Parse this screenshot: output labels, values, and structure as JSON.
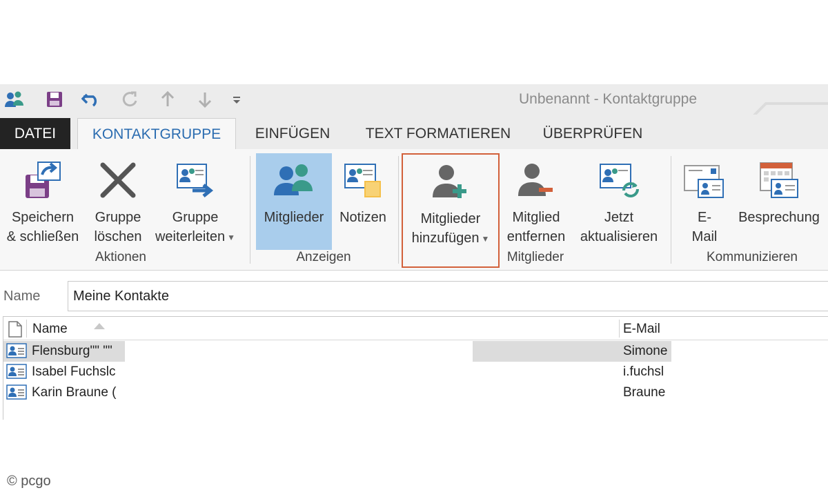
{
  "window": {
    "title": "Unbenannt - Kontaktgruppe"
  },
  "tabs": [
    {
      "label": "DATEI"
    },
    {
      "label": "KONTAKTGRUPPE"
    },
    {
      "label": "EINFÜGEN"
    },
    {
      "label": "TEXT FORMATIEREN"
    },
    {
      "label": "ÜBERPRÜFEN"
    }
  ],
  "ribbon": {
    "aktionen": {
      "label": "Aktionen",
      "speichern": {
        "line1": "Speichern",
        "line2": "& schließen"
      },
      "loeschen": {
        "line1": "Gruppe",
        "line2": "löschen"
      },
      "weiterleiten": {
        "line1": "Gruppe",
        "line2": "weiterleiten"
      }
    },
    "anzeigen": {
      "label": "Anzeigen",
      "mitglieder": "Mitglieder",
      "notizen": "Notizen"
    },
    "mitglieder": {
      "label": "Mitglieder",
      "hinzufuegen": {
        "line1": "Mitglieder",
        "line2": "hinzufügen"
      },
      "entfernen": {
        "line1": "Mitglied",
        "line2": "entfernen"
      },
      "aktualisieren": {
        "line1": "Jetzt",
        "line2": "aktualisieren"
      }
    },
    "kommunizieren": {
      "label": "Kommunizieren",
      "email": {
        "line1": "E-",
        "line2": "Mail"
      },
      "besprechung": "Besprechung"
    }
  },
  "name_field": {
    "label": "Name",
    "value": "Meine Kontakte"
  },
  "list": {
    "columns": {
      "name": "Name",
      "email": "E-Mail"
    },
    "rows": [
      {
        "name": "Flensburg\"\" \"\"",
        "email": "Simone"
      },
      {
        "name": "Isabel Fuchslc",
        "email": "i.fuchsl"
      },
      {
        "name": "Karin Braune (",
        "email": "Braune"
      }
    ]
  },
  "watermark": "© pcgo",
  "colors": {
    "accent": "#2b6cb0",
    "selected": "#a9cdec",
    "outline": "#d2603a",
    "file_tab": "#232323"
  }
}
